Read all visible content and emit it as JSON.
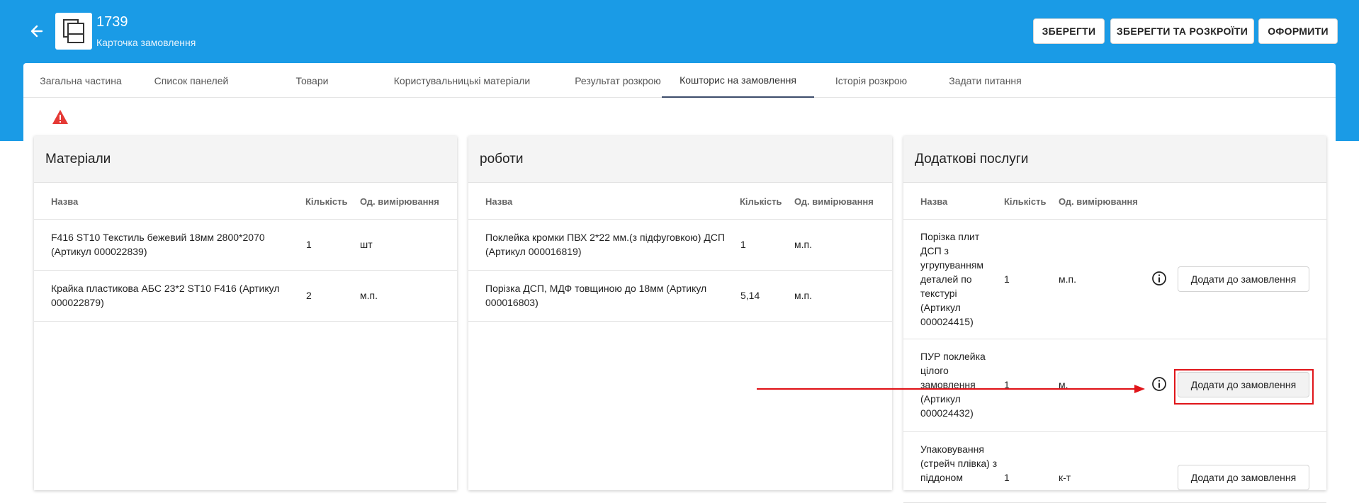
{
  "header": {
    "order_number": "1739",
    "order_subtitle": "Карточка замовлення",
    "buttons": {
      "save": "ЗБЕРЕГТИ",
      "save_and_cut": "ЗБЕРЕГТИ ТА РОЗКРОЇТИ",
      "checkout": "ОФОРМИТИ"
    },
    "back_icon": "arrow-left-icon",
    "logo_icon": "order-document-icon"
  },
  "tabs": [
    {
      "label": "Загальна частина"
    },
    {
      "label": "Список панелей"
    },
    {
      "label": "Товари"
    },
    {
      "label": "Користувальницькі матеріали"
    },
    {
      "label": "Результат розкрою"
    },
    {
      "label": "Кошторис на замовлення"
    },
    {
      "label": "Історія розкрою"
    },
    {
      "label": "Задати питання"
    }
  ],
  "active_tab": "Кошторис на замовлення",
  "warning_icon": "warning-triangle-icon",
  "materials": {
    "title": "Матеріали",
    "columns": {
      "name": "Назва",
      "qty": "Кількість",
      "unit": "Од. вимірювання"
    },
    "rows": [
      {
        "name": "F416 ST10 Текстиль бежевий 18мм 2800*2070 (Артикул 000022839)",
        "qty": "1",
        "unit": "шт"
      },
      {
        "name": "Крайка пластикова АБС 23*2 ST10 F416 (Артикул 000022879)",
        "qty": "2",
        "unit": "м.п."
      }
    ]
  },
  "works": {
    "title": "роботи",
    "columns": {
      "name": "Назва",
      "qty": "Кількість",
      "unit": "Од. вимірювання"
    },
    "rows": [
      {
        "name": "Поклейка кромки ПВХ 2*22 мм.(з підфуговкою) ДСП (Артикул 000016819)",
        "qty": "1",
        "unit": "м.п."
      },
      {
        "name": "Порізка ДСП, МДФ товщиною до 18мм (Артикул 000016803)",
        "qty": "5,14",
        "unit": "м.п."
      }
    ]
  },
  "services": {
    "title": "Додаткові послуги",
    "columns": {
      "name": "Назва",
      "qty": "Кількість",
      "unit": "Од. вимірювання"
    },
    "add_label": "Додати до замовлення",
    "rows": [
      {
        "name": "Порізка плит ДСП з угрупуванням деталей по текстурі (Артикул 000024415)",
        "qty": "1",
        "unit": "м.п."
      },
      {
        "name": "ПУР поклейка цілого замовлення (Артикул 000024432)",
        "qty": "1",
        "unit": "м."
      },
      {
        "name": "Упаковування (стрейч плівка) з піддоном",
        "qty": "1",
        "unit": "к-т"
      }
    ]
  },
  "colors": {
    "header_bg": "#1a9be6",
    "highlight": "#e0151a",
    "active_tab_line": "#3d4c6b"
  }
}
